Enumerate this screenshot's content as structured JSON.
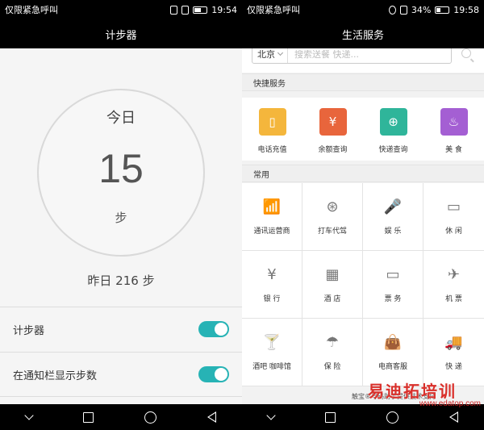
{
  "left": {
    "status": {
      "carrier": "仅限紧急呼叫",
      "time": "19:54"
    },
    "title": "计步器",
    "today_label": "今日",
    "steps": "15",
    "steps_unit": "步",
    "yesterday": "昨日 216 步",
    "settings": [
      {
        "label": "计步器",
        "enabled": true
      },
      {
        "label": "在通知栏显示步数",
        "enabled": true
      }
    ]
  },
  "right": {
    "status": {
      "carrier": "仅限紧急呼叫",
      "battery": "34%",
      "time": "19:58"
    },
    "title": "生活服务",
    "search": {
      "city": "北京",
      "placeholder": "搜索送餐 快递..."
    },
    "quick_title": "快捷服务",
    "quick_items": [
      {
        "label": "电话充值",
        "icon": "phone-icon",
        "color": "#f4b63c",
        "glyph": "▯"
      },
      {
        "label": "余额查询",
        "icon": "balance-icon",
        "color": "#e8653c",
        "glyph": "¥"
      },
      {
        "label": "快递查询",
        "icon": "parcel-icon",
        "color": "#2fb59a",
        "glyph": "⊕"
      },
      {
        "label": "美 食",
        "icon": "chef-hat-icon",
        "color": "#a45fd3",
        "glyph": "♨"
      }
    ],
    "common_title": "常用",
    "common_items": [
      {
        "label": "通讯运营商",
        "icon": "signal-icon",
        "glyph": "📶"
      },
      {
        "label": "打车代驾",
        "icon": "steering-wheel-icon",
        "glyph": "⊛"
      },
      {
        "label": "娱 乐",
        "icon": "microphone-icon",
        "glyph": "🎤"
      },
      {
        "label": "休 闲",
        "icon": "video-icon",
        "glyph": "▭"
      },
      {
        "label": "银 行",
        "icon": "bank-icon",
        "glyph": "¥"
      },
      {
        "label": "酒 店",
        "icon": "hotel-icon",
        "glyph": "▦"
      },
      {
        "label": "票 务",
        "icon": "ticket-icon",
        "glyph": "▭"
      },
      {
        "label": "机 票",
        "icon": "plane-icon",
        "glyph": "✈"
      },
      {
        "label": "酒吧 咖啡馆",
        "icon": "cocktail-icon",
        "glyph": "🍸"
      },
      {
        "label": "保 险",
        "icon": "umbrella-icon",
        "glyph": "☂"
      },
      {
        "label": "电商客服",
        "icon": "shopping-bag-icon",
        "glyph": "👜"
      },
      {
        "label": "快 递",
        "icon": "truck-icon",
        "glyph": "🚚"
      }
    ],
    "footer": "触宝®号码助手提供技术支持"
  },
  "watermark": {
    "top": "易迪拓培训",
    "bottom": "www.edatop.com"
  }
}
